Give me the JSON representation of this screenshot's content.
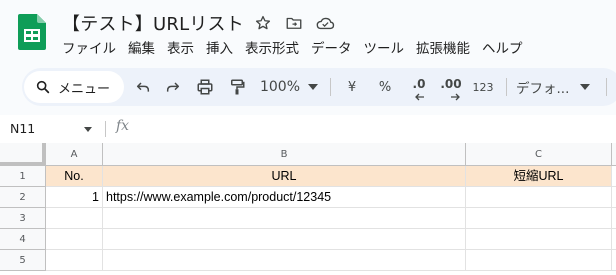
{
  "document": {
    "title": "【テスト】URLリスト"
  },
  "menu": [
    "ファイル",
    "編集",
    "表示",
    "挿入",
    "表示形式",
    "データ",
    "ツール",
    "拡張機能",
    "ヘルプ"
  ],
  "toolbar": {
    "search_label": "メニュー",
    "zoom": "100%",
    "currency": "¥",
    "percent": "%",
    "decrease_decimal": ".0",
    "increase_decimal": ".00",
    "number_format": "123",
    "font_name": "デフォ..."
  },
  "formula_bar": {
    "cell_ref": "N11",
    "formula": ""
  },
  "sheet": {
    "columns": [
      "A",
      "B",
      "C"
    ],
    "rows": [
      "1",
      "2",
      "3",
      "4",
      "5"
    ],
    "header_fill": "#fce5cd",
    "cells": {
      "A1": "No.",
      "B1": "URL",
      "C1": "短縮URL",
      "A2": "1",
      "B2": "https://www.example.com/product/12345",
      "C2": ""
    }
  },
  "colors": {
    "brand_green": "#0f9d58",
    "toolbar_bg": "#edf2fa"
  }
}
